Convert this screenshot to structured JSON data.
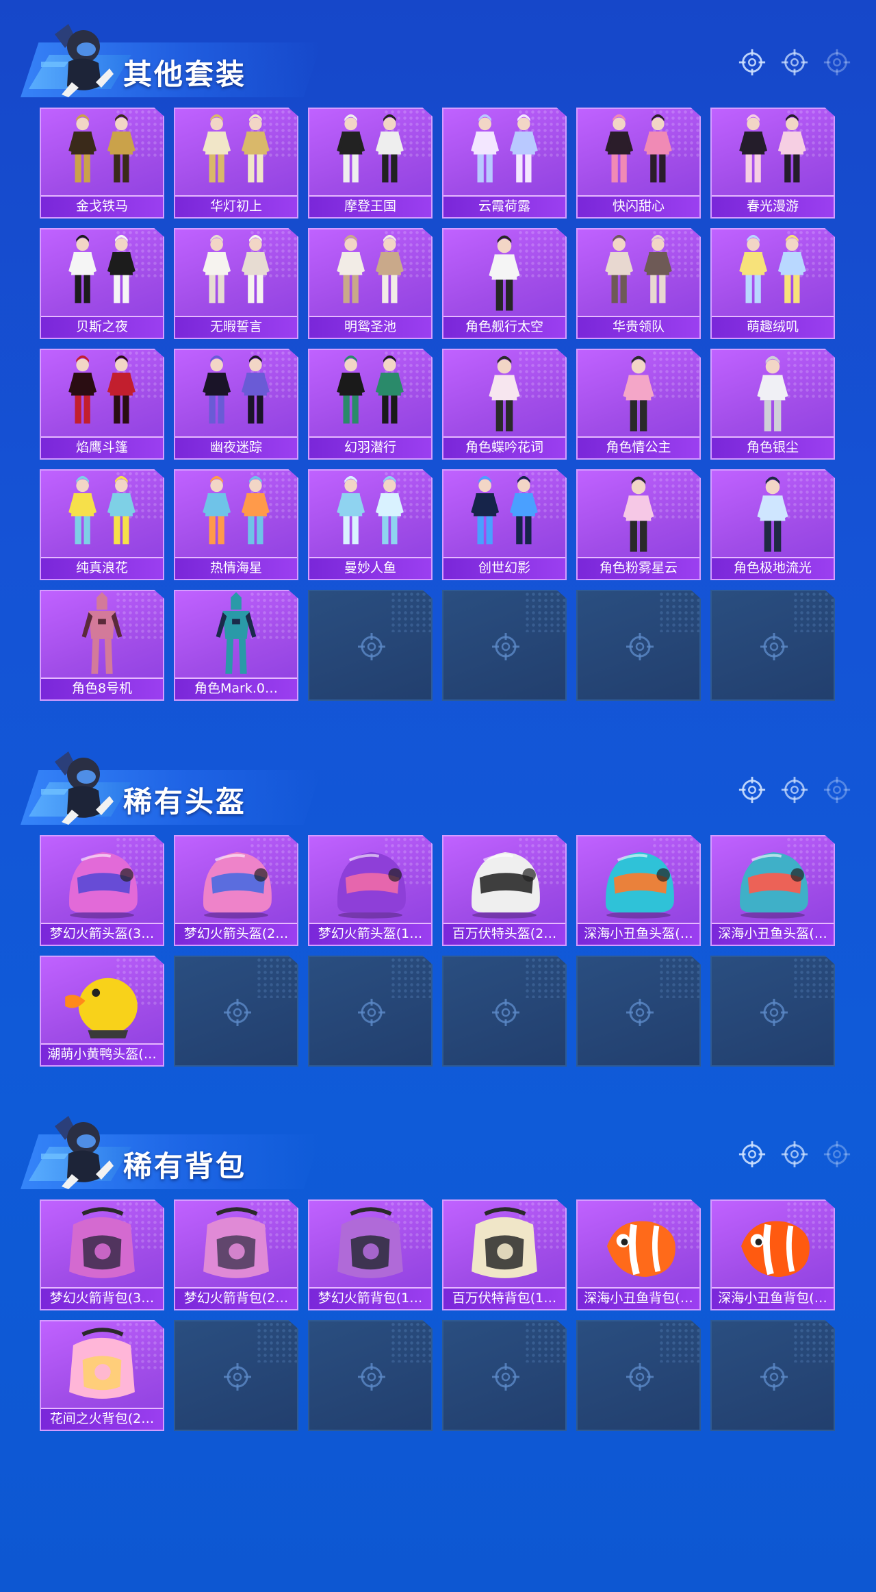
{
  "sections": [
    {
      "title": "其他套装",
      "items": [
        {
          "label": "金戈铁马",
          "kind": "outfit-pair",
          "c1": "#3a2a1a",
          "c2": "#caa24a"
        },
        {
          "label": "华灯初上",
          "kind": "outfit-pair",
          "c1": "#f1e6c8",
          "c2": "#d9b86a"
        },
        {
          "label": "摩登王国",
          "kind": "outfit-pair",
          "c1": "#222222",
          "c2": "#eeeeee"
        },
        {
          "label": "云霞荷露",
          "kind": "outfit-pair",
          "c1": "#f3e7ff",
          "c2": "#b9c9ff"
        },
        {
          "label": "快闪甜心",
          "kind": "outfit-pair",
          "c1": "#2b1d2a",
          "c2": "#f08ab5"
        },
        {
          "label": "春光漫游",
          "kind": "outfit-pair",
          "c1": "#241d2a",
          "c2": "#f6cfe3"
        },
        {
          "label": "贝斯之夜",
          "kind": "outfit-pair",
          "c1": "#f5f5f5",
          "c2": "#1c1c1c"
        },
        {
          "label": "无暇誓言",
          "kind": "outfit-pair",
          "c1": "#f6f3ef",
          "c2": "#e7dcd2"
        },
        {
          "label": "明鸳圣池",
          "kind": "outfit-pair",
          "c1": "#f2ece6",
          "c2": "#c9a98a"
        },
        {
          "label": "角色舰行太空",
          "kind": "character",
          "c1": "#f5f5f5",
          "c2": "#262626"
        },
        {
          "label": "华贵领队",
          "kind": "outfit-pair",
          "c1": "#e8d8d0",
          "c2": "#6e5a56"
        },
        {
          "label": "萌趣绒叽",
          "kind": "outfit-pair",
          "c1": "#f7e27a",
          "c2": "#b9d8ff"
        },
        {
          "label": "焰鹰斗篷",
          "kind": "outfit-pair",
          "c1": "#2a0d12",
          "c2": "#c21f2e"
        },
        {
          "label": "幽夜迷踪",
          "kind": "outfit-pair",
          "c1": "#1a1428",
          "c2": "#6a5bd6"
        },
        {
          "label": "幻羽潜行",
          "kind": "outfit-pair",
          "c1": "#1a1a1a",
          "c2": "#2a8a6a"
        },
        {
          "label": "角色蝶吟花词",
          "kind": "character",
          "c1": "#f7e6ef",
          "c2": "#2a2a2a"
        },
        {
          "label": "角色情公主",
          "kind": "character",
          "c1": "#f4a6c8",
          "c2": "#2a2a2a"
        },
        {
          "label": "角色银尘",
          "kind": "character",
          "c1": "#f0f0f5",
          "c2": "#cfcfd8"
        },
        {
          "label": "纯真浪花",
          "kind": "outfit-pair",
          "c1": "#f6e04a",
          "c2": "#7ed0e6"
        },
        {
          "label": "热情海星",
          "kind": "outfit-pair",
          "c1": "#6fc3e8",
          "c2": "#ff9a4a"
        },
        {
          "label": "曼妙人鱼",
          "kind": "outfit-pair",
          "c1": "#8fd3f0",
          "c2": "#d9f2ff"
        },
        {
          "label": "创世幻影",
          "kind": "outfit-pair",
          "c1": "#16244a",
          "c2": "#4aa0ff"
        },
        {
          "label": "角色粉雾星云",
          "kind": "character",
          "c1": "#f6c8e6",
          "c2": "#2a2a2a"
        },
        {
          "label": "角色极地流光",
          "kind": "character",
          "c1": "#cfe6ff",
          "c2": "#1f2a44"
        },
        {
          "label": "角色8号机",
          "kind": "mecha",
          "c1": "#d37a9a",
          "c2": "#5a2a3a"
        },
        {
          "label": "角色Mark.0…",
          "kind": "mecha",
          "c1": "#2a9aa8",
          "c2": "#1a2a4a"
        },
        null,
        null,
        null,
        null
      ]
    },
    {
      "title": "稀有头盔",
      "items": [
        {
          "label": "梦幻火箭头盔(3…",
          "kind": "helmet",
          "c1": "#e26ad8",
          "c2": "#5a49d6"
        },
        {
          "label": "梦幻火箭头盔(2…",
          "kind": "helmet",
          "c1": "#ee83c9",
          "c2": "#4a6ae0"
        },
        {
          "label": "梦幻火箭头盔(1…",
          "kind": "helmet",
          "c1": "#8e3fd8",
          "c2": "#f06aa8"
        },
        {
          "label": "百万伏特头盔(2…",
          "kind": "helmet",
          "c1": "#efefef",
          "c2": "#2a2a2a"
        },
        {
          "label": "深海小丑鱼头盔(…",
          "kind": "helmet",
          "c1": "#2fc2d8",
          "c2": "#ff7a2a"
        },
        {
          "label": "深海小丑鱼头盔(…",
          "kind": "helmet",
          "c1": "#3fb0c8",
          "c2": "#ff5a4a"
        },
        {
          "label": "潮萌小黄鸭头盔(…",
          "kind": "duck",
          "c1": "#f8d21a",
          "c2": "#ff8a1a"
        },
        null,
        null,
        null,
        null,
        null
      ]
    },
    {
      "title": "稀有背包",
      "items": [
        {
          "label": "梦幻火箭背包(3…",
          "kind": "backpack",
          "c1": "#d46ad0",
          "c2": "#3a2a4a"
        },
        {
          "label": "梦幻火箭背包(2…",
          "kind": "backpack",
          "c1": "#e08ad6",
          "c2": "#4a3a5a"
        },
        {
          "label": "梦幻火箭背包(1…",
          "kind": "backpack",
          "c1": "#b06ad8",
          "c2": "#2a2a3a"
        },
        {
          "label": "百万伏特背包(1…",
          "kind": "backpack",
          "c1": "#f0e6c8",
          "c2": "#2a2a2a"
        },
        {
          "label": "深海小丑鱼背包(…",
          "kind": "fish",
          "c1": "#ff6a1a",
          "c2": "#ffffff"
        },
        {
          "label": "深海小丑鱼背包(…",
          "kind": "fish",
          "c1": "#ff5a10",
          "c2": "#ffffff"
        },
        {
          "label": "花间之火背包(2…",
          "kind": "backpack",
          "c1": "#ffb6d8",
          "c2": "#ffd26a"
        },
        null,
        null,
        null,
        null,
        null
      ]
    }
  ]
}
